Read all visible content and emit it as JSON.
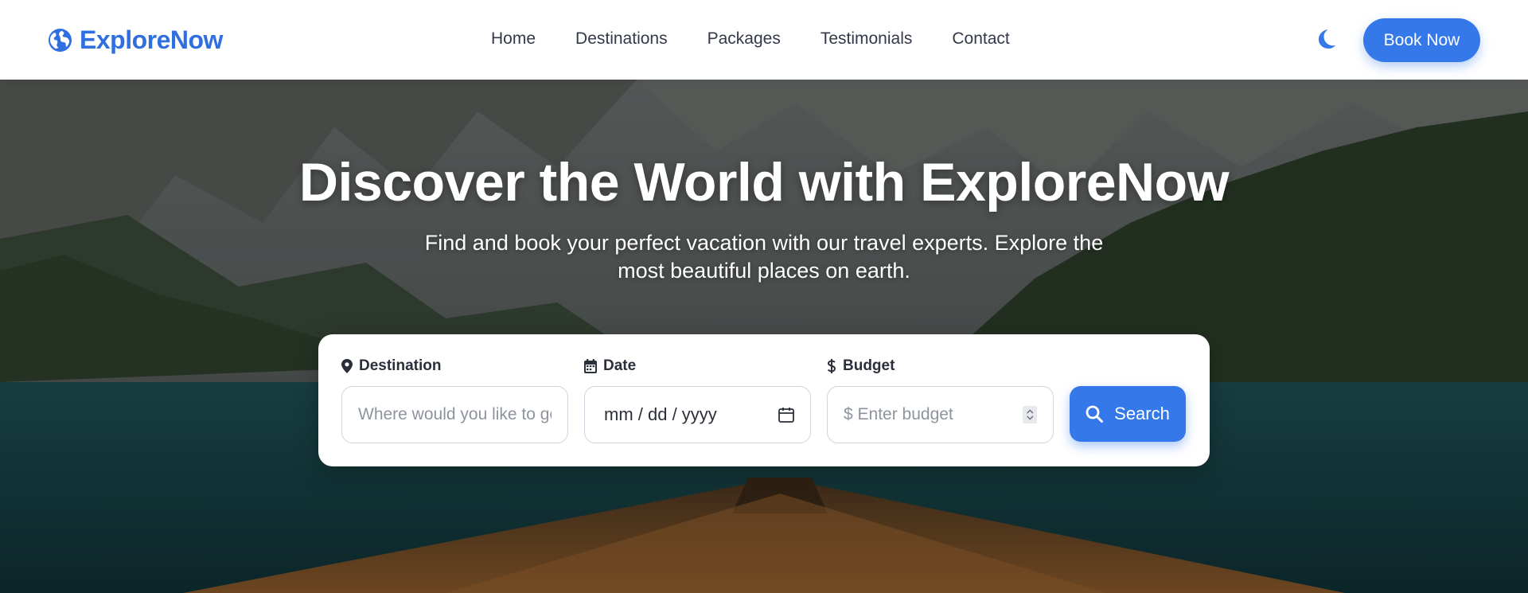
{
  "brand": {
    "name": "ExploreNow",
    "icon": "globe-icon",
    "color": "#2f6fdf"
  },
  "nav": {
    "items": [
      {
        "label": "Home"
      },
      {
        "label": "Destinations"
      },
      {
        "label": "Packages"
      },
      {
        "label": "Testimonials"
      },
      {
        "label": "Contact"
      }
    ]
  },
  "header": {
    "theme_toggle_icon": "moon-icon",
    "book_label": "Book Now"
  },
  "hero": {
    "title": "Discover the World with ExploreNow",
    "subtitle": "Find and book your perfect vacation with our travel experts. Explore the most beautiful places on earth."
  },
  "search": {
    "destination": {
      "label": "Destination",
      "icon": "map-pin-icon",
      "placeholder": "Where would you like to go?"
    },
    "date": {
      "label": "Date",
      "icon": "calendar-icon",
      "value": "mm / dd / yyyy"
    },
    "budget": {
      "label": "Budget",
      "icon": "dollar-icon",
      "placeholder": "$ Enter budget"
    },
    "button_label": "Search",
    "button_icon": "search-icon"
  },
  "colors": {
    "accent": "#3478ea",
    "text": "#33394a"
  }
}
